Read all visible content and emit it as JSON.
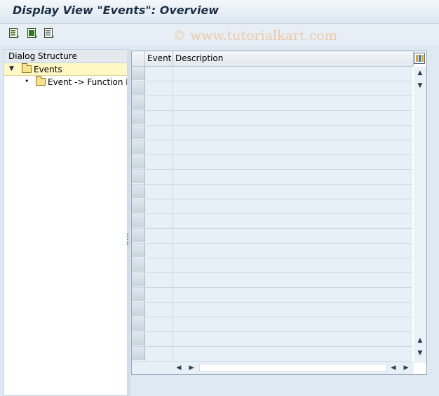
{
  "window": {
    "title": "Display View \"Events\": Overview"
  },
  "toolbar": {
    "buttons": [
      {
        "icon": "details-icon"
      },
      {
        "icon": "select-all-icon"
      },
      {
        "icon": "deselect-icon"
      }
    ]
  },
  "watermark": "© www.tutorialkart.com",
  "dialog_structure": {
    "header": "Dialog Structure",
    "items": [
      {
        "label": "Events",
        "expanded": true,
        "selected": true
      },
      {
        "label": "Event -> Function M"
      }
    ]
  },
  "table": {
    "columns": [
      {
        "label": "Event"
      },
      {
        "label": "Description"
      }
    ],
    "empty_rows": 20,
    "settings_icon": "table-settings-icon"
  },
  "colors": {
    "accent": "#1c3046",
    "selection": "#fff8c4",
    "row": "#e8f0f7"
  }
}
